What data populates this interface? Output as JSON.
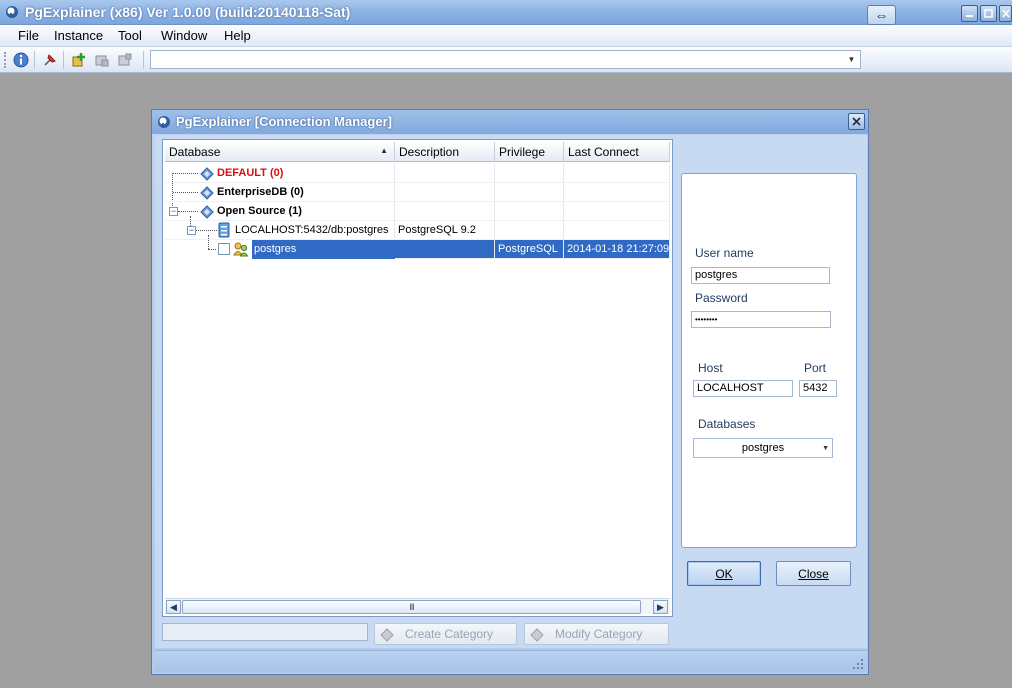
{
  "window": {
    "title": "PgExplainer (x86) Ver 1.0.00 (build:20140118-Sat)"
  },
  "menu": {
    "items": [
      "File",
      "Instance",
      "Tool",
      "Window",
      "Help"
    ]
  },
  "toolbar": {
    "combo_value": ""
  },
  "dialog": {
    "title": "PgExplainer [Connection Manager]",
    "tree": {
      "columns": [
        "Database",
        "Description",
        "Privilege",
        "Last Connect"
      ],
      "rows": [
        {
          "label": "DEFAULT (0)",
          "description": "",
          "privilege": "",
          "last_connect": ""
        },
        {
          "label": "EnterpriseDB (0)",
          "description": "",
          "privilege": "",
          "last_connect": ""
        },
        {
          "label": "Open Source (1)",
          "description": "",
          "privilege": "",
          "last_connect": ""
        },
        {
          "label": "LOCALHOST:5432/db:postgres",
          "description": "PostgreSQL 9.2",
          "privilege": "",
          "last_connect": ""
        },
        {
          "label": "postgres",
          "description": "",
          "privilege": "PostgreSQL",
          "last_connect": "2014-01-18 21:27:09"
        }
      ],
      "expander_symbol": "−",
      "scroll_thumb": "III"
    },
    "buttons": {
      "create_category": "Create Category",
      "modify_category": "Modify Category",
      "ok": "OK",
      "close": "Close"
    },
    "form": {
      "username_label": "User name",
      "username_value": "postgres",
      "password_label": "Password",
      "password_value": "••••••••",
      "host_label": "Host",
      "host_value": "LOCALHOST",
      "port_label": "Port",
      "port_value": "5432",
      "databases_label": "Databases",
      "databases_value": "postgres"
    }
  },
  "colors": {
    "selection": "#316ac5",
    "default_category": "#d41010"
  }
}
